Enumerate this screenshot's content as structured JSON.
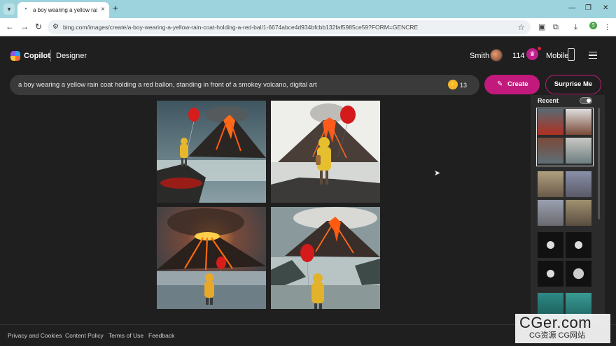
{
  "browser": {
    "tab_title": "a boy wearing a yellow rain coat",
    "tab_close": "×",
    "new_tab": "+",
    "url": "bing.com/images/create/a-boy-wearing-a-yellow-rain-coat-holding-a-red-bal/1-6674abce4d934bfcbb132faf5985ce59?FORM=GENCRE",
    "profile_initial": "S"
  },
  "header": {
    "brand": "Copilot",
    "section": "Designer",
    "user_name": "Smith",
    "rewards_count": "114",
    "mobile_label": "Mobile"
  },
  "prompt": {
    "text": "a boy wearing a yellow rain coat holding a red ballon, standing in front of a smokey volcano, digital art",
    "boost_count": "13"
  },
  "actions": {
    "create_label": "Create",
    "surprise_label": "Surprise Me"
  },
  "recent": {
    "title": "Recent"
  },
  "footer": {
    "links": [
      "Privacy and Cookies",
      "Content Policy",
      "Terms of Use",
      "Feedback"
    ]
  },
  "watermark": {
    "main": "CGer.com",
    "sub": "CG资源  CG网站"
  },
  "colors": {
    "accent": "#c11a7c",
    "page_bg": "#1f1f1f",
    "tabstrip_bg": "#9dd3dc"
  }
}
